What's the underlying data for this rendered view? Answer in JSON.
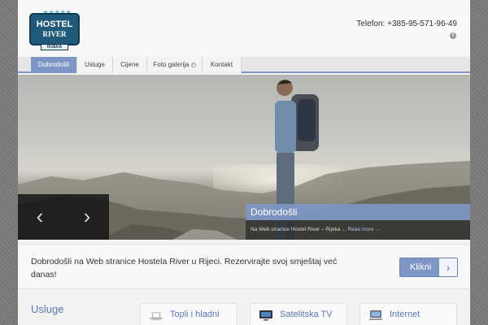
{
  "header": {
    "logo": {
      "line1": "HOSTEL",
      "line2": "RIVER",
      "ribbon": "RIJEKA"
    },
    "phone": "Telefon: +385-95-571-96-49",
    "social_icon": "facebook-icon"
  },
  "nav": {
    "items": [
      {
        "label": "Dobrodošli",
        "active": true
      },
      {
        "label": "Usluge"
      },
      {
        "label": "Cijene"
      },
      {
        "label": "Foto galerija",
        "has_dropdown": true
      },
      {
        "label": "Kontakt"
      }
    ]
  },
  "hero": {
    "prev_icon": "chevron-left-icon",
    "next_icon": "chevron-right-icon",
    "caption_title": "Dobrodošli",
    "caption_text": "Na Web stranice Hostel River – Rijeka ...",
    "read_more": "Read more →"
  },
  "welcome": {
    "text": "Dobrodošli na Web stranice Hostela River u Rijeci. Rezervirajte svoj smještaj već danas!",
    "button_label": "Klikni",
    "button_icon": "chevron-right-icon"
  },
  "services": {
    "title": "Usluge",
    "items": [
      {
        "label": "Topli i hladni",
        "icon": "coffee-cup-icon"
      },
      {
        "label": "Satelitska TV",
        "icon": "tv-icon"
      },
      {
        "label": "Internet",
        "icon": "computer-icon"
      }
    ]
  },
  "colors": {
    "accent": "#7d96c6",
    "heading": "#5b78b2",
    "logo_blue": "#1f5a7a"
  }
}
